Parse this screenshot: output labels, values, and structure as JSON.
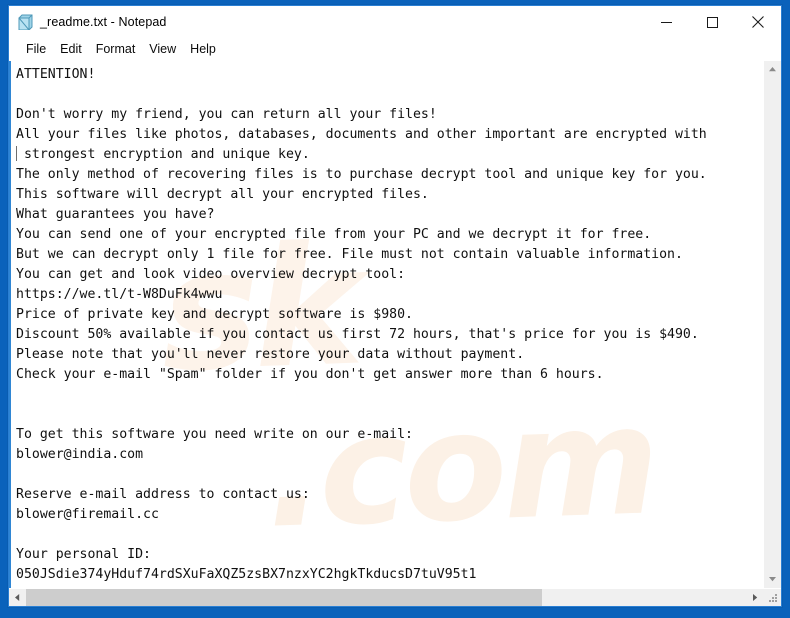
{
  "window": {
    "title": "_readme.txt - Notepad",
    "icon": "notepad-document-icon",
    "minimize_label": "Minimize",
    "maximize_label": "Maximize",
    "close_label": "Close"
  },
  "menu": {
    "items": [
      {
        "label": "File"
      },
      {
        "label": "Edit"
      },
      {
        "label": "Format"
      },
      {
        "label": "View"
      },
      {
        "label": "Help"
      }
    ]
  },
  "document": {
    "filename": "_readme.txt",
    "lines": [
      "ATTENTION!",
      "",
      "Don't worry my friend, you can return all your files!",
      "All your files like photos, databases, documents and other important are encrypted with",
      " strongest encryption and unique key.",
      "The only method of recovering files is to purchase decrypt tool and unique key for you.",
      "This software will decrypt all your encrypted files.",
      "What guarantees you have?",
      "You can send one of your encrypted file from your PC and we decrypt it for free.",
      "But we can decrypt only 1 file for free. File must not contain valuable information.",
      "You can get and look video overview decrypt tool:",
      "https://we.tl/t-W8DuFk4wwu",
      "Price of private key and decrypt software is $980.",
      "Discount 50% available if you contact us first 72 hours, that's price for you is $490.",
      "Please note that you'll never restore your data without payment.",
      "Check your e-mail \"Spam\" folder if you don't get answer more than 6 hours.",
      "",
      "",
      "To get this software you need write on our e-mail:",
      "blower@india.com",
      "",
      "Reserve e-mail address to contact us:",
      "blower@firemail.cc",
      "",
      "Your personal ID:",
      "050JSdie374yHduf74rdSXuFaXQZ5zsBX7nzxYC2hgkTkducsD7tuV95t1"
    ],
    "text_before_caret": "ATTENTION!\n\nDon't worry my friend, you can return all your files!\nAll your files like photos, databases, documents and other important are encrypted with\n",
    "text_after_caret": " strongest encryption and unique key.\nThe only method of recovering files is to purchase decrypt tool and unique key for you.\nThis software will decrypt all your encrypted files.\nWhat guarantees you have?\nYou can send one of your encrypted file from your PC and we decrypt it for free.\nBut we can decrypt only 1 file for free. File must not contain valuable information.\nYou can get and look video overview decrypt tool:\nhttps://we.tl/t-W8DuFk4wwu\nPrice of private key and decrypt software is $980.\nDiscount 50% available if you contact us first 72 hours, that's price for you is $490.\nPlease note that you'll never restore your data without payment.\nCheck your e-mail \"Spam\" folder if you don't get answer more than 6 hours.\n\n\nTo get this software you need write on our e-mail:\nblower@india.com\n\nReserve e-mail address to contact us:\nblower@firemail.cc\n\nYour personal ID:\n050JSdie374yHduf74rdSXuFaXQZ5zsBX7nzxYC2hgkTkducsD7tuV95t1",
    "ransom_price": "$980",
    "discount_price": "$490",
    "discount_percent": "50%",
    "discount_hours": "72 hours",
    "response_hours": "6 hours",
    "video_url": "https://we.tl/t-W8DuFk4wwu",
    "primary_email": "blower@india.com",
    "reserve_email": "blower@firemail.cc",
    "personal_id": "050JSdie374yHduf74rdSXuFaXQZ5zsBX7nzxYC2hgkTkducsD7tuV95t1"
  },
  "watermark": {
    "line1": "sk",
    "line2": ".com"
  },
  "scrollbars": {
    "vertical": {
      "up_label": "Scroll up",
      "down_label": "Scroll down",
      "thumb_visible": false
    },
    "horizontal": {
      "left_label": "Scroll left",
      "right_label": "Scroll right",
      "thumb_width_percent": "71.5"
    }
  },
  "colors": {
    "desktop_blue": "#0a62bb",
    "window_border": "#2a7fd4",
    "text_pane_edge": "#2f86d4",
    "scrollbar_track": "#f0f0f0",
    "scrollbar_thumb": "#cdcdcd",
    "text": "#101010",
    "watermark": "#fdf3ea"
  }
}
